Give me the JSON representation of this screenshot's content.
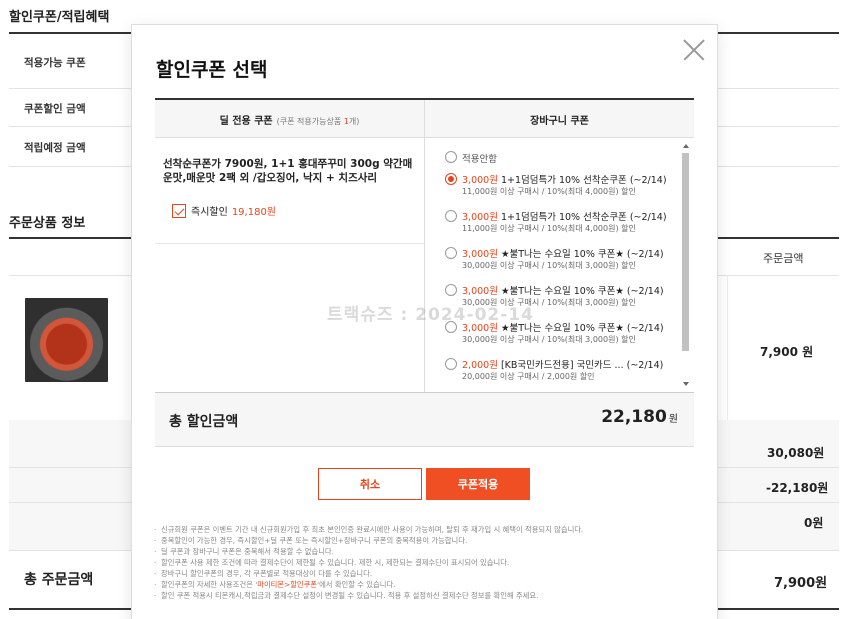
{
  "background": {
    "section_title": "할인쿠폰/적립혜택",
    "rows": [
      {
        "label": "적용가능 쿠폰"
      },
      {
        "label": "쿠폰할인 금액"
      },
      {
        "label": "적립예정 금액"
      }
    ],
    "product_section_title": "주문상품 정보",
    "column_header_order_amount": "주문금액",
    "product_price": "7,900 원",
    "summary": {
      "amount1": "30,080원",
      "amount2": "-22,180원",
      "amount3": "0원"
    },
    "total_order_label": "총 주문금액",
    "total_order_value": "7,900원"
  },
  "modal": {
    "title": "할인쿠폰 선택",
    "left_header": "딜 전용 쿠폰",
    "left_header_note_prefix": "(쿠폰 적용가능상품 ",
    "left_header_note_count": "1",
    "left_header_note_suffix": "개)",
    "right_header": "장바구니 쿠폰",
    "deal_title": "선착순쿠폰가 7900원, 1+1 홍대쭈꾸미 300g 약간매운맛,매운맛 2팩 외 /갑오징어, 낙지 + 치즈사리",
    "deal_checkbox_label": "즉시할인",
    "deal_checkbox_amount": "19,180원",
    "coupons": [
      {
        "selected": false,
        "price": "",
        "name": "적용안함",
        "condition": ""
      },
      {
        "selected": true,
        "price": "3,000원",
        "name": "1+1덤덤특가 10% 선착순쿠폰 (~2/14)",
        "condition": "11,000원 이상 구매시 / 10%(최대 4,000원) 할인"
      },
      {
        "selected": false,
        "price": "3,000원",
        "name": "1+1덤덤특가 10% 선착순쿠폰 (~2/14)",
        "condition": "11,000원 이상 구매시 / 10%(최대 4,000원) 할인"
      },
      {
        "selected": false,
        "price": "3,000원",
        "name": "★불T나는 수요일 10% 쿠폰★ (~2/14)",
        "condition": "30,000원 이상 구매시 / 10%(최대 3,000원) 할인"
      },
      {
        "selected": false,
        "price": "3,000원",
        "name": "★불T나는 수요일 10% 쿠폰★ (~2/14)",
        "condition": "30,000원 이상 구매시 / 10%(최대 3,000원) 할인"
      },
      {
        "selected": false,
        "price": "3,000원",
        "name": "★불T나는 수요일 10% 쿠폰★ (~2/14)",
        "condition": "30,000원 이상 구매시 / 10%(최대 3,000원) 할인"
      },
      {
        "selected": false,
        "price": "2,000원",
        "name": "[KB국민카드전용] 국민카드 ... (~2/14)",
        "condition": "20,000원 이상 구매시 / 2,000원 할인"
      }
    ],
    "total_label": "총 할인금액",
    "total_value": "22,180",
    "total_unit": "원",
    "cancel_label": "취소",
    "apply_label": "쿠폰적용",
    "notes": [
      "신규회원 쿠폰은 이벤트 기간 내 신규회원가입 후 최초 본인인증 완료시에만 사용이 가능하며, 탈퇴 후 재가입 시 혜택이 적용되지 않습니다.",
      "중복할인이 가능한 경우, 즉시할인+딜 쿠폰 또는 즉시할인+장바구니 쿠폰의 중복적용이 가능합니다.",
      "딜 쿠폰과 장바구니 쿠폰은 중복해서 적용할 수 없습니다.",
      "할인쿠폰 사용 제한 조건에 따라 결제수단이 제한될 수 있습니다. 제한 시, 제한되는 결제수단이 표시되어 있습니다.",
      "장바구니 할인쿠폰의 경우, 각 쿠폰별로 적용대상이 다를 수 있습니다."
    ],
    "note_link_prefix": "할인쿠폰의 자세한 사용조건은 '",
    "note_link_text": "마이티몬>할인쿠폰",
    "note_link_suffix": "'에서 확인할 수 있습니다.",
    "note_last": "할인 쿠폰 적용시 티몬캐시,적립금과 결제수단 설정이 변경될 수 있습니다. 적용 후 설정하신 결제수단 정보를 확인해 주세요."
  },
  "watermark": "트랙슈즈 : 2024-02-14"
}
